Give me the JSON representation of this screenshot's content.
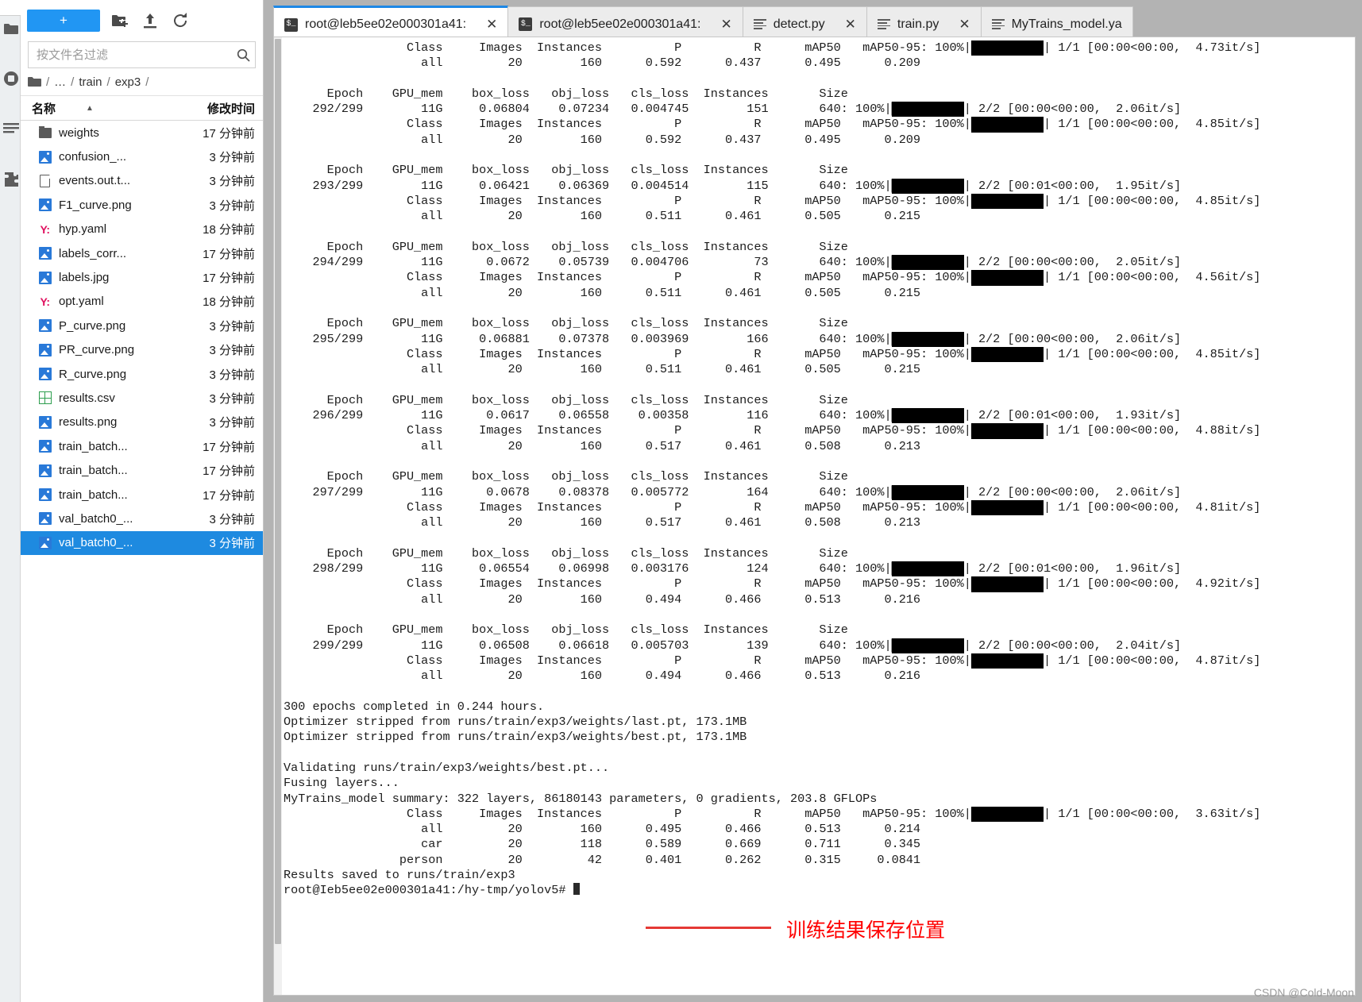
{
  "rail": {
    "icons": [
      {
        "name": "folder-icon",
        "glyph": "folder"
      },
      {
        "name": "running-terminals-icon",
        "glyph": "power"
      },
      {
        "name": "commands-icon",
        "glyph": "list"
      },
      {
        "name": "extensions-icon",
        "glyph": "puzzle"
      }
    ]
  },
  "explorer": {
    "new_button_label": "+",
    "new_folder_icon": "new-folder-icon",
    "upload_icon": "upload-icon",
    "refresh_icon": "refresh-icon",
    "filter": {
      "placeholder": "按文件名过滤",
      "value": "",
      "search_icon": "search-icon"
    },
    "breadcrumb": {
      "root_icon": "folder-icon",
      "parts": [
        "/",
        "…",
        "/",
        "train",
        "/",
        "exp3",
        "/"
      ]
    },
    "columns": {
      "name": "名称",
      "modified": "修改时间",
      "sort_caret": "▲"
    },
    "files": [
      {
        "name": "weights",
        "time": "17 分钟前",
        "icon": "folder-icon",
        "type": "folder",
        "selected": false
      },
      {
        "name": "confusion_...",
        "time": "3 分钟前",
        "icon": "image-icon",
        "type": "image",
        "selected": false
      },
      {
        "name": "events.out.t...",
        "time": "3 分钟前",
        "icon": "file-icon",
        "type": "file",
        "selected": false
      },
      {
        "name": "F1_curve.png",
        "time": "3 分钟前",
        "icon": "image-icon",
        "type": "image",
        "selected": false
      },
      {
        "name": "hyp.yaml",
        "time": "18 分钟前",
        "icon": "yaml-icon",
        "type": "yaml",
        "selected": false
      },
      {
        "name": "labels_corr...",
        "time": "17 分钟前",
        "icon": "image-icon",
        "type": "image",
        "selected": false
      },
      {
        "name": "labels.jpg",
        "time": "17 分钟前",
        "icon": "image-icon",
        "type": "image",
        "selected": false
      },
      {
        "name": "opt.yaml",
        "time": "18 分钟前",
        "icon": "yaml-icon",
        "type": "yaml",
        "selected": false
      },
      {
        "name": "P_curve.png",
        "time": "3 分钟前",
        "icon": "image-icon",
        "type": "image",
        "selected": false
      },
      {
        "name": "PR_curve.png",
        "time": "3 分钟前",
        "icon": "image-icon",
        "type": "image",
        "selected": false
      },
      {
        "name": "R_curve.png",
        "time": "3 分钟前",
        "icon": "image-icon",
        "type": "image",
        "selected": false
      },
      {
        "name": "results.csv",
        "time": "3 分钟前",
        "icon": "csv-icon",
        "type": "csv",
        "selected": false
      },
      {
        "name": "results.png",
        "time": "3 分钟前",
        "icon": "image-icon",
        "type": "image",
        "selected": false
      },
      {
        "name": "train_batch...",
        "time": "17 分钟前",
        "icon": "image-icon",
        "type": "image",
        "selected": false
      },
      {
        "name": "train_batch...",
        "time": "17 分钟前",
        "icon": "image-icon",
        "type": "image",
        "selected": false
      },
      {
        "name": "train_batch...",
        "time": "17 分钟前",
        "icon": "image-icon",
        "type": "image",
        "selected": false
      },
      {
        "name": "val_batch0_...",
        "time": "3 分钟前",
        "icon": "image-icon",
        "type": "image",
        "selected": false
      },
      {
        "name": "val_batch0_...",
        "time": "3 分钟前",
        "icon": "image-icon",
        "type": "image",
        "selected": true
      }
    ],
    "accent_color": "#2196f3",
    "selection_color": "#1e8ae0"
  },
  "tabs": [
    {
      "label": "root@leb5ee02e000301a41:",
      "icon": "terminal-icon",
      "close": "✕",
      "active": true
    },
    {
      "label": "root@leb5ee02e000301a41:",
      "icon": "terminal-icon",
      "close": "✕",
      "active": false
    },
    {
      "label": "detect.py",
      "icon": "document-icon",
      "close": "✕",
      "active": false
    },
    {
      "label": "train.py",
      "icon": "document-icon",
      "close": "✕",
      "active": false
    },
    {
      "label": "MyTrains_model.ya",
      "icon": "document-icon",
      "close": "",
      "active": false
    }
  ],
  "terminal": {
    "lines": [
      "                 Class     Images  Instances          P          R      mAP50   mAP50-95: 100%|██████████| 1/1 [00:00<00:00,  4.73it/s]",
      "                   all         20        160      0.592      0.437      0.495      0.209",
      "",
      "      Epoch    GPU_mem    box_loss   obj_loss   cls_loss  Instances       Size",
      "    292/299        11G     0.06804    0.07234   0.004745        151       640: 100%|██████████| 2/2 [00:00<00:00,  2.06it/s]",
      "                 Class     Images  Instances          P          R      mAP50   mAP50-95: 100%|██████████| 1/1 [00:00<00:00,  4.85it/s]",
      "                   all         20        160      0.592      0.437      0.495      0.209",
      "",
      "      Epoch    GPU_mem    box_loss   obj_loss   cls_loss  Instances       Size",
      "    293/299        11G     0.06421    0.06369   0.004514        115       640: 100%|██████████| 2/2 [00:01<00:00,  1.95it/s]",
      "                 Class     Images  Instances          P          R      mAP50   mAP50-95: 100%|██████████| 1/1 [00:00<00:00,  4.85it/s]",
      "                   all         20        160      0.511      0.461      0.505      0.215",
      "",
      "      Epoch    GPU_mem    box_loss   obj_loss   cls_loss  Instances       Size",
      "    294/299        11G      0.0672    0.05739   0.004706         73       640: 100%|██████████| 2/2 [00:00<00:00,  2.05it/s]",
      "                 Class     Images  Instances          P          R      mAP50   mAP50-95: 100%|██████████| 1/1 [00:00<00:00,  4.56it/s]",
      "                   all         20        160      0.511      0.461      0.505      0.215",
      "",
      "      Epoch    GPU_mem    box_loss   obj_loss   cls_loss  Instances       Size",
      "    295/299        11G     0.06881    0.07378   0.003969        166       640: 100%|██████████| 2/2 [00:00<00:00,  2.06it/s]",
      "                 Class     Images  Instances          P          R      mAP50   mAP50-95: 100%|██████████| 1/1 [00:00<00:00,  4.85it/s]",
      "                   all         20        160      0.511      0.461      0.505      0.215",
      "",
      "      Epoch    GPU_mem    box_loss   obj_loss   cls_loss  Instances       Size",
      "    296/299        11G      0.0617    0.06558    0.00358        116       640: 100%|██████████| 2/2 [00:01<00:00,  1.93it/s]",
      "                 Class     Images  Instances          P          R      mAP50   mAP50-95: 100%|██████████| 1/1 [00:00<00:00,  4.88it/s]",
      "                   all         20        160      0.517      0.461      0.508      0.213",
      "",
      "      Epoch    GPU_mem    box_loss   obj_loss   cls_loss  Instances       Size",
      "    297/299        11G      0.0678    0.08378   0.005772        164       640: 100%|██████████| 2/2 [00:00<00:00,  2.06it/s]",
      "                 Class     Images  Instances          P          R      mAP50   mAP50-95: 100%|██████████| 1/1 [00:00<00:00,  4.81it/s]",
      "                   all         20        160      0.517      0.461      0.508      0.213",
      "",
      "      Epoch    GPU_mem    box_loss   obj_loss   cls_loss  Instances       Size",
      "    298/299        11G     0.06554    0.06998   0.003176        124       640: 100%|██████████| 2/2 [00:01<00:00,  1.96it/s]",
      "                 Class     Images  Instances          P          R      mAP50   mAP50-95: 100%|██████████| 1/1 [00:00<00:00,  4.92it/s]",
      "                   all         20        160      0.494      0.466      0.513      0.216",
      "",
      "      Epoch    GPU_mem    box_loss   obj_loss   cls_loss  Instances       Size",
      "    299/299        11G     0.06508    0.06618   0.005703        139       640: 100%|██████████| 2/2 [00:00<00:00,  2.04it/s]",
      "                 Class     Images  Instances          P          R      mAP50   mAP50-95: 100%|██████████| 1/1 [00:00<00:00,  4.87it/s]",
      "                   all         20        160      0.494      0.466      0.513      0.216",
      "",
      "300 epochs completed in 0.244 hours.",
      "Optimizer stripped from runs/train/exp3/weights/last.pt, 173.1MB",
      "Optimizer stripped from runs/train/exp3/weights/best.pt, 173.1MB",
      "",
      "Validating runs/train/exp3/weights/best.pt...",
      "Fusing layers...",
      "MyTrains_model summary: 322 layers, 86180143 parameters, 0 gradients, 203.8 GFLOPs",
      "                 Class     Images  Instances          P          R      mAP50   mAP50-95: 100%|██████████| 1/1 [00:00<00:00,  3.63it/s]",
      "                   all         20        160      0.495      0.466      0.513      0.214",
      "                   car         20        118      0.589      0.669      0.711      0.345",
      "                person         20         42      0.401      0.262      0.315     0.0841",
      "Results saved to runs/train/exp3",
      "root@Ieb5ee02e000301a41:/hy-tmp/yolov5# "
    ],
    "prompt_cursor": "block-cursor"
  },
  "annotation": {
    "text": "训练结果保存位置",
    "color": "#ff0000",
    "underline_color": "#e53935",
    "underlined_target": "runs/train/exp3"
  },
  "watermark": "CSDN @Cold-Moon"
}
